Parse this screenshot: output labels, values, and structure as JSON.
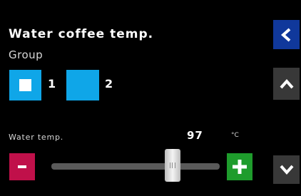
{
  "screen": {
    "title": "Water coffee temp."
  },
  "group": {
    "label": "Group",
    "options": [
      {
        "number": "1",
        "selected": true
      },
      {
        "number": "2",
        "selected": false
      }
    ],
    "selected_color": "#0fa6e8"
  },
  "slider": {
    "label": "Water temp.",
    "value": "97",
    "unit": "°C",
    "position_fraction": 0.72
  },
  "buttons": {
    "back_icon": "chevron-left-icon",
    "up_icon": "chevron-up-icon",
    "down_icon": "chevron-down-icon",
    "minus_icon": "minus-icon",
    "plus_icon": "plus-icon"
  },
  "colors": {
    "background": "#000000",
    "back_button": "#10389b",
    "nav_button": "#383838",
    "minus_button": "#c0104a",
    "plus_button": "#1e9c2c"
  }
}
